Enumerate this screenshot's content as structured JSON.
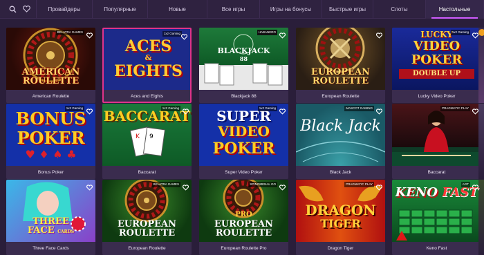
{
  "nav": {
    "tabs": [
      {
        "label": "Провайдеры",
        "active": false
      },
      {
        "label": "Популярные",
        "active": false
      },
      {
        "label": "Новые",
        "active": false
      },
      {
        "label": "Все игры",
        "active": false
      },
      {
        "label": "Игры на бонусы",
        "active": false
      },
      {
        "label": "Быстрые игры",
        "active": false
      },
      {
        "label": "Слоты",
        "active": false
      },
      {
        "label": "Настольные",
        "active": true
      }
    ],
    "accent_color": "#d05cff"
  },
  "games": [
    {
      "name": "American Roulette",
      "art_title": [
        "AMERICAN",
        "ROULETTE"
      ],
      "provider": "BELATRA GAMES",
      "icon": "roulette-wheel"
    },
    {
      "name": "Aces and Eights",
      "art_title": [
        "ACES",
        "&",
        "EIGHTS"
      ],
      "provider": "1x2 Gaming",
      "icon": "playing-cards"
    },
    {
      "name": "Blackjack 88",
      "art_title": [
        "BLACKJACK",
        "88"
      ],
      "provider": "HABANERO",
      "icon": "playing-cards"
    },
    {
      "name": "European Roulette",
      "art_title": [
        "EUROPEAN",
        "ROULETTE"
      ],
      "provider": "",
      "icon": "roulette-wheel"
    },
    {
      "name": "Lucky Video Poker",
      "art_title": [
        "LUCKY",
        "VIDEO",
        "POKER",
        "DOUBLE UP"
      ],
      "provider": "1x2 Gaming",
      "icon": "poker"
    },
    {
      "name": "Bonus Poker",
      "art_title": [
        "BONUS",
        "POKER"
      ],
      "provider": "1x2 Gaming",
      "icon": "poker"
    },
    {
      "name": "Baccarat",
      "art_title": [
        "BACCARAT"
      ],
      "provider": "1x2 Gaming",
      "icon": "playing-cards"
    },
    {
      "name": "Super Video Poker",
      "art_title": [
        "SUPER",
        "VIDEO",
        "POKER"
      ],
      "provider": "1x2 Gaming",
      "icon": "poker"
    },
    {
      "name": "Black Jack",
      "art_title": [
        "Black",
        "Jack"
      ],
      "provider": "MASCOT GAMING",
      "icon": "table"
    },
    {
      "name": "Baccarat",
      "art_title": [],
      "provider": "PRAGMATIC PLAY",
      "icon": "live-dealer"
    },
    {
      "name": "Three Face Cards",
      "art_title": [
        "THREE",
        "FACE",
        "CARDS"
      ],
      "provider": "",
      "icon": "anime"
    },
    {
      "name": "European Roulette",
      "art_title": [
        "EUROPEAN",
        "ROULETTE"
      ],
      "provider": "BELATRA GAMES",
      "icon": "roulette-wheel"
    },
    {
      "name": "European Roulette Pro",
      "art_title": [
        "PRO",
        "EUROPEAN",
        "ROULETTE"
      ],
      "provider": "SPINOMENAL GO",
      "icon": "roulette-wheel"
    },
    {
      "name": "Dragon Tiger",
      "art_title": [
        "DRAGON",
        "TIGER"
      ],
      "provider": "PRAGMATIC PLAY",
      "icon": "dragon"
    },
    {
      "name": "Keno Fast",
      "art_title": [
        "KENO",
        "FAST"
      ],
      "provider": "AGT",
      "icon": "keno"
    }
  ]
}
